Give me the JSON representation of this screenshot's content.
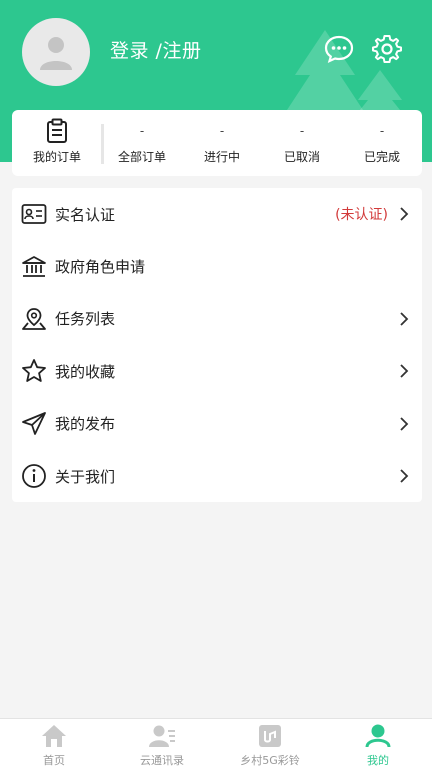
{
  "header": {
    "login_text": "登录 /注册",
    "message_icon": "message-icon",
    "settings_icon": "gear-icon",
    "avatar_icon": "user-avatar-icon"
  },
  "orders": {
    "main_label": "我的订单",
    "main_icon": "clipboard-icon",
    "stats": [
      {
        "count": "-",
        "label": "全部订单"
      },
      {
        "count": "-",
        "label": "进行中"
      },
      {
        "count": "-",
        "label": "已取消"
      },
      {
        "count": "-",
        "label": "已完成"
      }
    ]
  },
  "menu": {
    "items": [
      {
        "label": "实名认证",
        "status": "(未认证)",
        "icon": "id-card-icon",
        "arrow": true
      },
      {
        "label": "政府角色申请",
        "status": "",
        "icon": "government-building-icon",
        "arrow": false
      },
      {
        "label": "任务列表",
        "status": "",
        "icon": "location-pin-icon",
        "arrow": true
      },
      {
        "label": "我的收藏",
        "status": "",
        "icon": "star-icon",
        "arrow": true
      },
      {
        "label": "我的发布",
        "status": "",
        "icon": "paper-plane-icon",
        "arrow": true
      },
      {
        "label": "关于我们",
        "status": "",
        "icon": "info-icon",
        "arrow": true
      }
    ]
  },
  "tabbar": {
    "tabs": [
      {
        "label": "首页",
        "icon": "home-icon",
        "active": false
      },
      {
        "label": "云通讯录",
        "icon": "contacts-icon",
        "active": false
      },
      {
        "label": "乡村5G彩铃",
        "icon": "ringtone-icon",
        "active": false
      },
      {
        "label": "我的",
        "icon": "profile-icon",
        "active": true
      }
    ]
  },
  "colors": {
    "accent": "#2dc78f",
    "status_red": "#d23a3a",
    "inactive_tab": "#999999"
  }
}
